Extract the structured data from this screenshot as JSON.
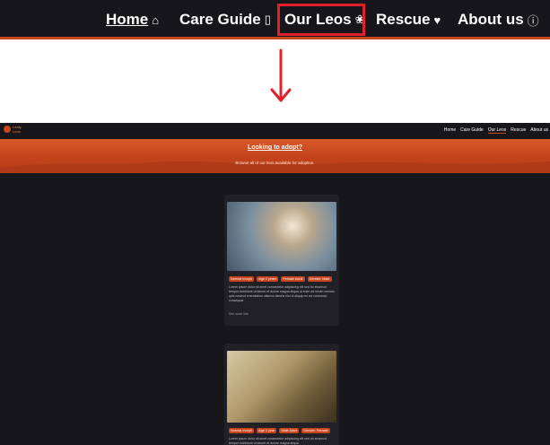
{
  "zoom_nav": {
    "home": "Home",
    "care": "Care Guide",
    "leos": "Our Leos",
    "rescue": "Rescue",
    "about": "About us"
  },
  "mini": {
    "brand": "Leafy Leos",
    "links": [
      "Home",
      "Care Guide",
      "Our Leos",
      "Rescue",
      "About us"
    ],
    "banner_title": "Looking to adopt?",
    "banner_sub": "Browse all of our leos available for adoption."
  },
  "cards": [
    {
      "tags": [
        "Normal morph",
        "Age 2 years",
        "Female Adult",
        "Gender: Male"
      ],
      "desc": "Lorem ipsum dolor sit amet consectetur adipiscing elit sed do eiusmod tempor incididunt ut labore et dolore magna aliqua ut enim ad minim veniam quis nostrud exercitation ullamco laboris nisi ut aliquip ex ea commodo consequat.",
      "more": "See more info"
    },
    {
      "tags": [
        "Normal morph",
        "Age 1 year",
        "Male Adult",
        "Gender: Female"
      ],
      "desc": "Lorem ipsum dolor sit amet consectetur adipiscing elit sed do eiusmod tempor incididunt ut labore et dolore magna aliqua."
    }
  ],
  "colors": {
    "accent": "#c8451e",
    "highlight": "#e0202a",
    "bg": "#17171b"
  }
}
